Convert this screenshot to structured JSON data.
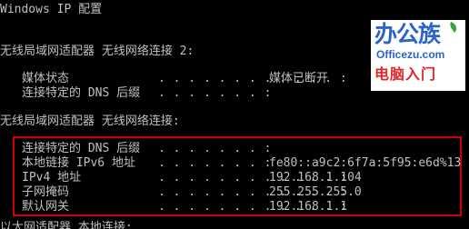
{
  "console": {
    "title_line": "Windows IP 配置",
    "adapter2_header": "无线局域网适配器 无线网络连接 2:",
    "adapter2_rows": [
      {
        "label": "媒体状态",
        "dots": ". . . . . . . . . . . . :",
        "value": "媒体已断开"
      },
      {
        "label": "连接特定的 DNS 后缀",
        "dots": ". . . . . . . :",
        "value": ""
      }
    ],
    "adapter1_header": "无线局域网适配器 无线网络连接:",
    "adapter1_rows": [
      {
        "label": "连接特定的 DNS 后缀",
        "dots": ". . . . . . . :",
        "value": ""
      },
      {
        "label": "本地链接 IPv6 地址",
        "dots": ". . . . . . . :",
        "value": "fe80::a9c2:6f7a:5f95:e6d%13"
      },
      {
        "label": "IPv4 地址",
        "dots": ". . . . . . . . . . . . :",
        "value": "192.168.1.104"
      },
      {
        "label": "子网掩码",
        "dots": ". . . . . . . . . . . . :",
        "value": "255.255.255.0"
      },
      {
        "label": "默认网关",
        "dots": ". . . . . . . . . . . . :",
        "value": "192.168.1.1"
      }
    ],
    "bottom_partial": "以太网适配器 本地连接:"
  },
  "logo": {
    "cn": "办公族",
    "en": "Officezu.com",
    "tag": "电脑入门",
    "colors": {
      "blue": "#2b63c6",
      "red": "#e0262c",
      "green": "#3aa33a"
    }
  },
  "highlight_color": "#d10000"
}
